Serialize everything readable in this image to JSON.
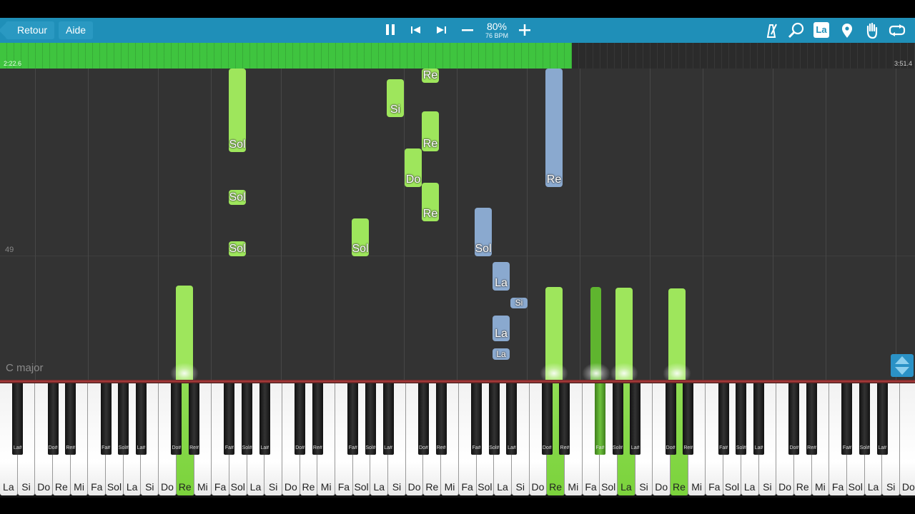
{
  "toolbar": {
    "back_label": "Retour",
    "help_label": "Aide",
    "speed_percent": "80%",
    "speed_bpm": "76 BPM",
    "note_label_button": "La",
    "icons": [
      "pause-icon",
      "skip-back-icon",
      "skip-forward-icon",
      "minus-icon",
      "plus-icon",
      "metronome-icon",
      "magnifier-icon",
      "note-label-icon",
      "location-pin-icon",
      "hand-icon",
      "loop-icon"
    ]
  },
  "progress": {
    "elapsed": "2:22.6",
    "total": "3:51.4",
    "fraction": 0.625
  },
  "roll": {
    "bar_number": "49",
    "key_signature": "C major"
  },
  "notes": [
    {
      "label": "Sol",
      "hand": "right"
    },
    {
      "label": "Sol",
      "hand": "right"
    },
    {
      "label": "Sol",
      "hand": "right"
    },
    {
      "label": "Sol",
      "hand": "right"
    },
    {
      "label": "Si",
      "hand": "right"
    },
    {
      "label": "Re",
      "hand": "right"
    },
    {
      "label": "Re",
      "hand": "right"
    },
    {
      "label": "Do",
      "hand": "right"
    },
    {
      "label": "Re",
      "hand": "right"
    },
    {
      "label": "Sol",
      "hand": "left"
    },
    {
      "label": "La",
      "hand": "left"
    },
    {
      "label": "Si",
      "hand": "left"
    },
    {
      "label": "La",
      "hand": "left"
    },
    {
      "label": "La",
      "hand": "left"
    },
    {
      "label": "Re",
      "hand": "left"
    }
  ],
  "keyboard": {
    "white_keys": [
      "La",
      "Si",
      "Do",
      "Re",
      "Mi",
      "Fa",
      "Sol",
      "La",
      "Si",
      "Do",
      "Re",
      "Mi",
      "Fa",
      "Sol",
      "La",
      "Si",
      "Do",
      "Re",
      "Mi",
      "Fa",
      "Sol",
      "La",
      "Si",
      "Do",
      "Re",
      "Mi",
      "Fa",
      "Sol",
      "La",
      "Si",
      "Do",
      "Re",
      "Mi",
      "Fa",
      "Sol",
      "La",
      "Si",
      "Do",
      "Re",
      "Mi",
      "Fa",
      "Sol",
      "La",
      "Si",
      "Do",
      "Re",
      "Mi",
      "Fa",
      "Sol",
      "La",
      "Si",
      "Do"
    ],
    "black_keys": [
      "La#",
      "Do#",
      "Re#",
      "Fa#",
      "Sol#",
      "La#",
      "Do#",
      "Re#",
      "Fa#",
      "Sol#",
      "La#",
      "Do#",
      "Re#",
      "Fa#",
      "Sol#",
      "La#",
      "Do#",
      "Re#",
      "Fa#",
      "Sol#",
      "La#",
      "Do#",
      "Re#",
      "Fa#",
      "Sol#",
      "La#",
      "Do#",
      "Re#",
      "Fa#",
      "Sol#",
      "La#",
      "Do#",
      "Re#",
      "Fa#",
      "Sol#",
      "La#"
    ],
    "pressed_white": [
      10,
      31,
      35,
      38
    ],
    "pressed_black": [
      23
    ],
    "colors": {
      "right_hand": "#9ee65c",
      "left_hand": "#8aa9cf",
      "progress": "#3fc43f",
      "toolbar": "#1f8fb8"
    }
  }
}
